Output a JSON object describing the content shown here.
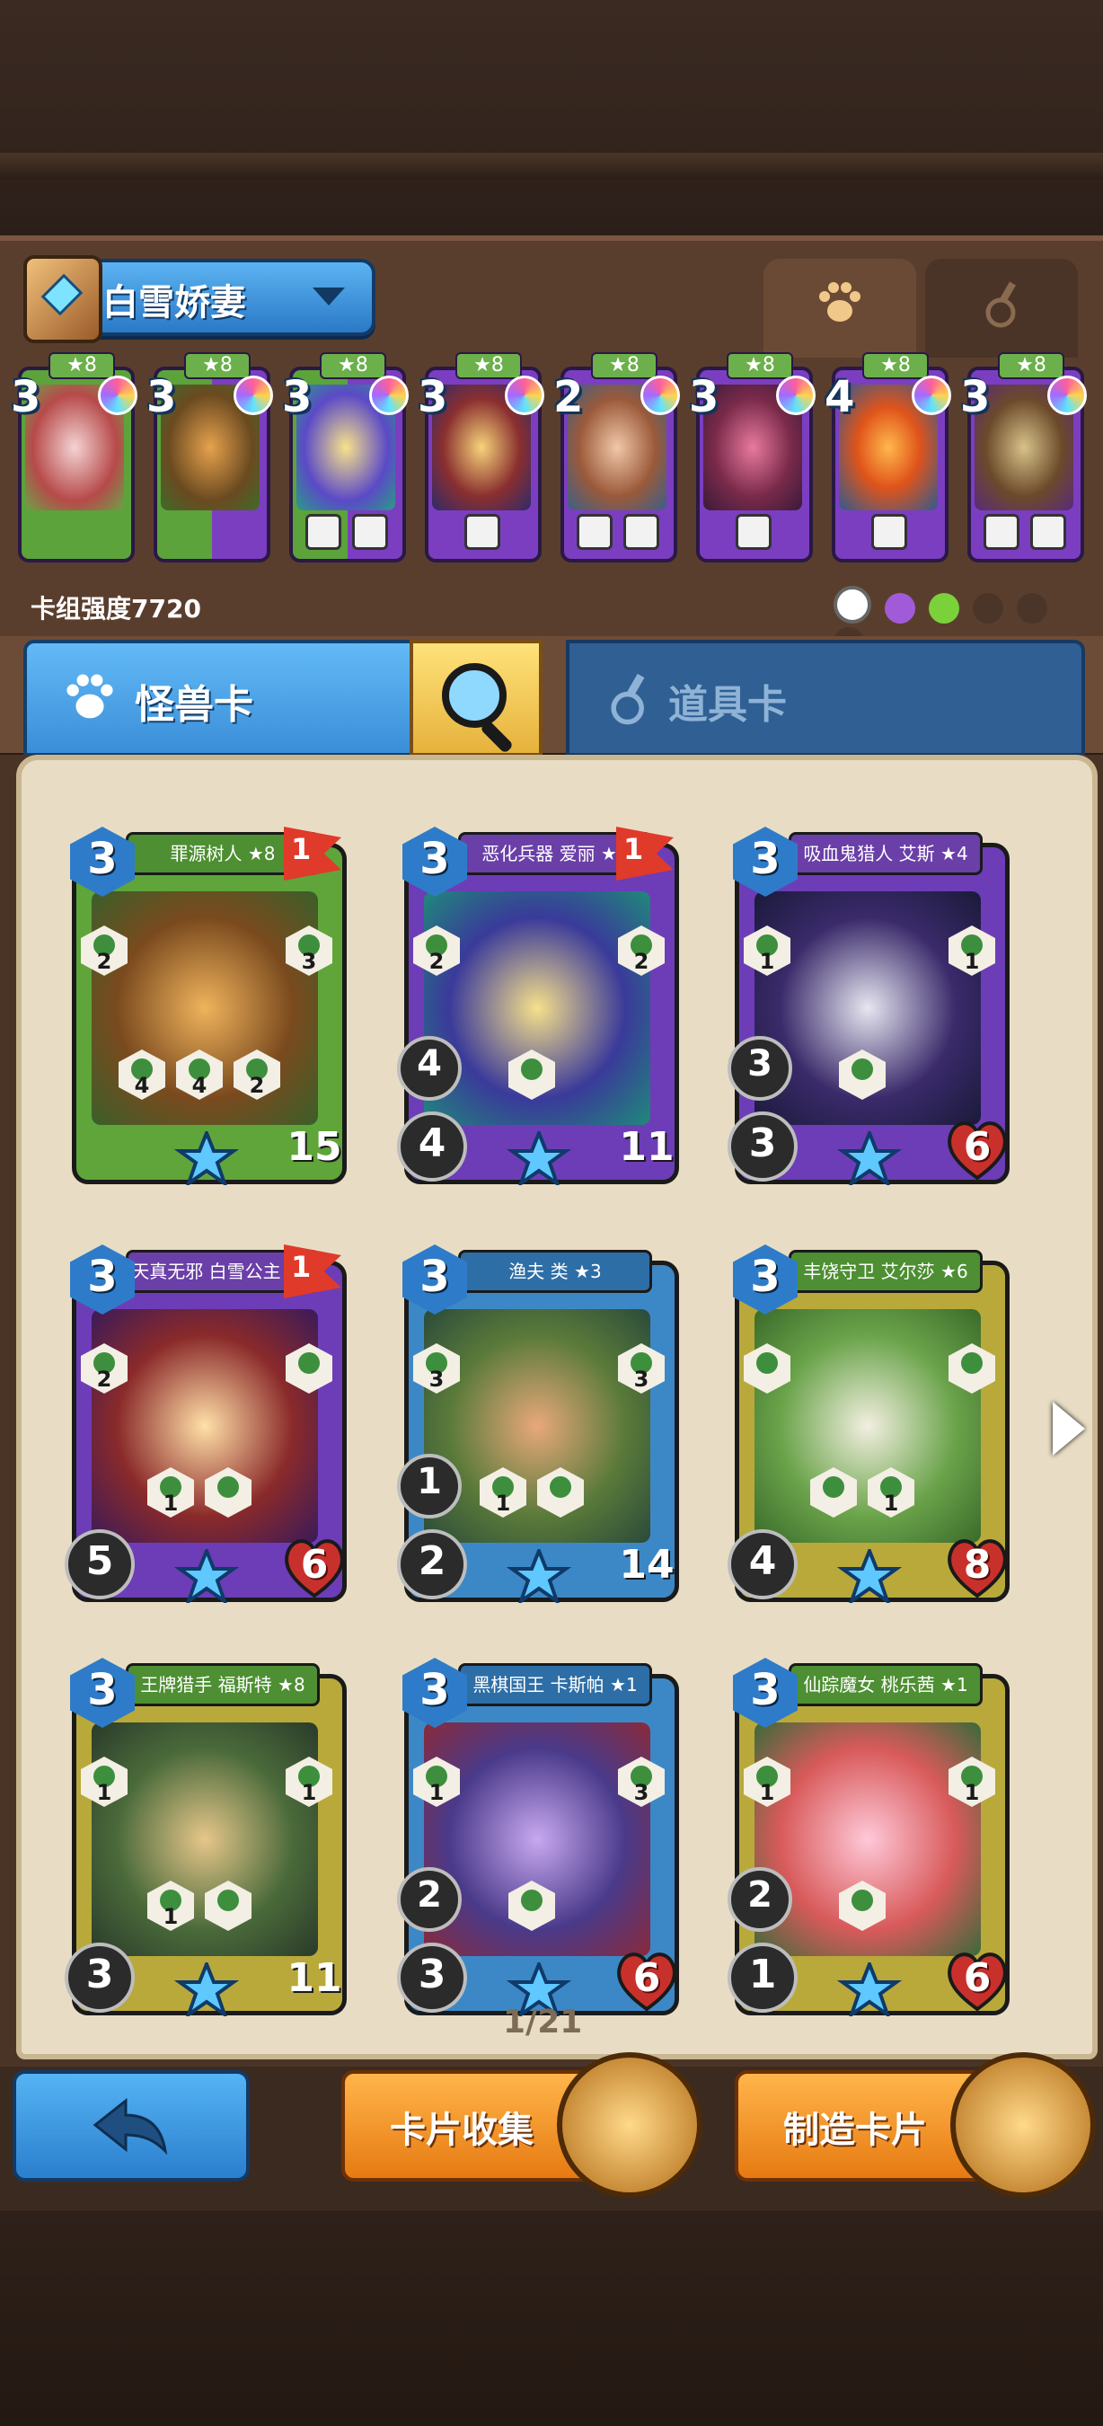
{
  "deck": {
    "name": "白雪娇妻",
    "strength_label": "卡组强度7720"
  },
  "deck_cards": [
    {
      "cost": "3",
      "stars": "★8",
      "color": "green"
    },
    {
      "cost": "3",
      "stars": "★8",
      "color": "half"
    },
    {
      "cost": "3",
      "stars": "★8",
      "color": "half"
    },
    {
      "cost": "3",
      "stars": "★8",
      "color": "purple"
    },
    {
      "cost": "2",
      "stars": "★8",
      "color": "purple"
    },
    {
      "cost": "3",
      "stars": "★8",
      "color": "purple"
    },
    {
      "cost": "4",
      "stars": "★8",
      "color": "purple"
    },
    {
      "cost": "3",
      "stars": "★8",
      "color": "purple"
    }
  ],
  "tabs": {
    "monster": "怪兽卡",
    "item": "道具卡"
  },
  "cards": [
    {
      "name": "罪源树人 ★8",
      "cost": "3",
      "flag": "1",
      "attack": "",
      "mid": "",
      "hp": "15",
      "hex": [
        "4",
        "4",
        "2"
      ],
      "left_hex": "2",
      "right_hex": "3",
      "theme": "g"
    },
    {
      "name": "恶化兵器 爱丽 ★8",
      "cost": "3",
      "flag": "1",
      "attack": "4",
      "mid": "4",
      "hp": "11",
      "hex": [
        ""
      ],
      "left_hex": "2",
      "right_hex": "2",
      "theme": "p"
    },
    {
      "name": "吸血鬼猎人 艾斯 ★4",
      "cost": "3",
      "flag": "",
      "attack": "3",
      "mid": "3",
      "hp": "6",
      "hex": [
        ""
      ],
      "left_hex": "1",
      "right_hex": "1",
      "theme": "p"
    },
    {
      "name": "天真无邪 白雪公主 ★8",
      "cost": "3",
      "flag": "1",
      "attack": "5",
      "mid": "",
      "hp": "6",
      "hex": [
        "1",
        ""
      ],
      "left_hex": "2",
      "right_hex": "",
      "theme": "p"
    },
    {
      "name": "渔夫 类 ★3",
      "cost": "3",
      "flag": "",
      "attack": "2",
      "mid": "1",
      "hp": "14",
      "hex": [
        "1",
        ""
      ],
      "left_hex": "3",
      "right_hex": "3",
      "theme": "b"
    },
    {
      "name": "丰饶守卫 艾尔莎 ★6",
      "cost": "3",
      "flag": "",
      "attack": "4",
      "mid": "",
      "hp": "8",
      "hex": [
        "",
        "1"
      ],
      "left_hex": "",
      "right_hex": "",
      "theme": "y"
    },
    {
      "name": "王牌猎手 福斯特 ★8",
      "cost": "3",
      "flag": "",
      "attack": "3",
      "mid": "",
      "hp": "11",
      "hex": [
        "1",
        ""
      ],
      "left_hex": "1",
      "right_hex": "1",
      "theme": "y"
    },
    {
      "name": "黑棋国王 卡斯帕 ★1",
      "cost": "3",
      "flag": "",
      "attack": "3",
      "mid": "2",
      "hp": "6",
      "hex": [
        ""
      ],
      "left_hex": "1",
      "right_hex": "3",
      "theme": "b"
    },
    {
      "name": "仙踪魔女 桃乐茜 ★1",
      "cost": "3",
      "flag": "",
      "attack": "1",
      "mid": "2",
      "hp": "6",
      "hex": [
        ""
      ],
      "left_hex": "1",
      "right_hex": "1",
      "theme": "y"
    }
  ],
  "pager": "1/21",
  "buttons": {
    "collect": "卡片收集",
    "craft": "制造卡片"
  }
}
